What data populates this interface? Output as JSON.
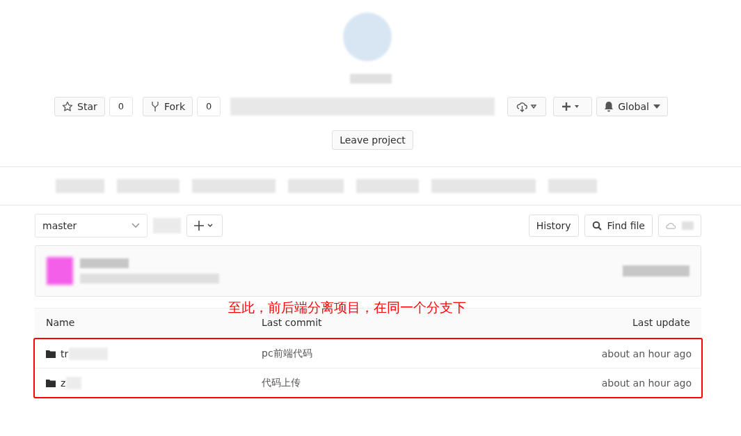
{
  "project_actions": {
    "star": {
      "label": "Star",
      "count": "0"
    },
    "fork": {
      "label": "Fork",
      "count": "0"
    },
    "notification": "Global"
  },
  "leave_button": "Leave project",
  "branch_select": {
    "value": "master"
  },
  "toolbar_buttons": [
    "History",
    "Find file"
  ],
  "annotation": {
    "text": "至此，前后端分离项目，在同一个分支下"
  },
  "table": {
    "columns": [
      "Name",
      "Last commit",
      "Last update"
    ],
    "rows": [
      {
        "name": "tr",
        "commit": "pc前端代码",
        "updated": "about an hour ago"
      },
      {
        "name": "z",
        "commit": "代码上传",
        "updated": "about an hour ago"
      }
    ]
  }
}
